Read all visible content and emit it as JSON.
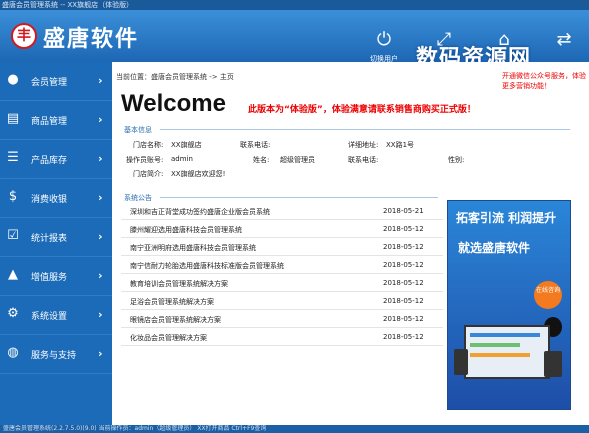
{
  "titlebar": {
    "text": "盛唐会员管理系统 -- XX旗舰店（体验版）"
  },
  "header": {
    "brand": "盛唐软件",
    "logo_char": "丰",
    "buttons": [
      {
        "icon": "power-icon",
        "label": "切换用户"
      },
      {
        "icon": "fullscreen-icon",
        "label": ""
      },
      {
        "icon": "home-icon",
        "label": ""
      },
      {
        "icon": "swap-icon",
        "label": ""
      }
    ],
    "watermark": "数码资源网"
  },
  "sidebar": {
    "items": [
      {
        "label": "会员管理",
        "icon": "user-icon"
      },
      {
        "label": "商品管理",
        "icon": "document-icon"
      },
      {
        "label": "产品库存",
        "icon": "database-icon"
      },
      {
        "label": "消费收银",
        "icon": "money-bag-icon"
      },
      {
        "label": "统计报表",
        "icon": "clipboard-icon"
      },
      {
        "label": "增值服务",
        "icon": "chart-icon"
      },
      {
        "label": "系统设置",
        "icon": "gear-icon"
      },
      {
        "label": "服务与支持",
        "icon": "globe-icon"
      }
    ]
  },
  "main": {
    "breadcrumb": "当前位置：盛唐会员管理系统 -> 主页",
    "notice": "开通微信公众号服务，体验更多营销功能！",
    "welcome": "Welcome",
    "trial_notice": "此版本为“体验版”，体验满意请联系销售商购买正式版！",
    "basic_info_title": "基本信息",
    "info": {
      "store_name_label": "门店名称:",
      "store_name": "XX旗舰店",
      "contact_phone_label": "联系电话:",
      "address_label": "详细地址:",
      "address": "XX路1号",
      "operator_label": "操作员账号:",
      "operator": "admin",
      "name_label": "姓名:",
      "name": "超级管理员",
      "phone_label": "联系电话:",
      "gender_label": "性别:",
      "intro_label": "门店简介:",
      "intro": "XX旗舰店欢迎您!"
    },
    "announce_title": "系统公告",
    "announcements": [
      {
        "title": "深圳和吉正背堂成功签约盛唐企业版会员系统",
        "date": "2018-05-21"
      },
      {
        "title": "滕州耀迎选用盛唐科技会员管理系统",
        "date": "2018-05-12"
      },
      {
        "title": "南宁亚洲明府选用盛唐科技会员管理系统",
        "date": "2018-05-12"
      },
      {
        "title": "南宁信耐力轮胎选用盛唐科技标准版会员管理系统",
        "date": "2018-05-12"
      },
      {
        "title": "教育培训会员管理系统解决方案",
        "date": "2018-05-12"
      },
      {
        "title": "足浴会员管理系统解决方案",
        "date": "2018-05-12"
      },
      {
        "title": "眼镜店会员管理系统解决方案",
        "date": "2018-05-12"
      },
      {
        "title": "化妆品会员管理解决方案",
        "date": "2018-05-12"
      }
    ],
    "ad": {
      "headline": "拓客引流 利润提升",
      "subline": "就选盛唐软件",
      "bubble": "在线咨询"
    }
  },
  "statusbar": {
    "text": "盛唐会员管理系统(2.2.7.5.0)(9.0)    当前操作员：admin（超级管理员）  XX打开商品  Ctrl+F9查询"
  }
}
